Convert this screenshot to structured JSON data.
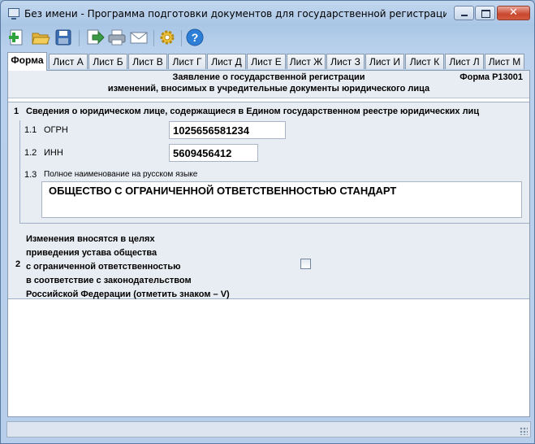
{
  "window": {
    "title": "Без имени - Программа подготовки документов для государственной регистрации. Версия ...",
    "controls": {
      "close": "✕"
    }
  },
  "toolbar": {
    "buttons": [
      "new-document-icon",
      "open-folder-icon",
      "save-icon",
      "export-icon",
      "print-icon",
      "email-icon",
      "settings-gear-icon",
      "help-icon"
    ]
  },
  "tabs": [
    {
      "label": "Форма",
      "active": true
    },
    {
      "label": "Лист А"
    },
    {
      "label": "Лист Б"
    },
    {
      "label": "Лист В"
    },
    {
      "label": "Лист Г"
    },
    {
      "label": "Лист Д"
    },
    {
      "label": "Лист Е"
    },
    {
      "label": "Лист Ж"
    },
    {
      "label": "Лист З"
    },
    {
      "label": "Лист И"
    },
    {
      "label": "Лист К"
    },
    {
      "label": "Лист Л"
    },
    {
      "label": "Лист М"
    }
  ],
  "form": {
    "code": "Форма Р13001",
    "title_line1": "Заявление о государственной регистрации",
    "title_line2": "изменений, вносимых в учредительные документы юридического лица",
    "section1": {
      "number": "1",
      "title": "Сведения о юридическом лице, содержащиеся в Едином государственном реестре юридических лиц",
      "ogrn": {
        "number": "1.1",
        "label": "ОГРН",
        "value": "1025656581234"
      },
      "inn": {
        "number": "1.2",
        "label": "ИНН",
        "value": "5609456412"
      },
      "name": {
        "number": "1.3",
        "label": "Полное наименование на русском языке",
        "value": "ОБЩЕСТВО С ОГРАНИЧЕННОЙ ОТВЕТСТВЕННОСТЬЮ СТАНДАРТ"
      }
    },
    "section2": {
      "number": "2",
      "lines": [
        "Изменения вносятся в целях",
        "приведения устава общества",
        "с ограниченной ответственностью",
        "в соответствие с законодательством",
        "Российской Федерации (отметить знаком – V)"
      ],
      "checked": false
    }
  },
  "colors": {
    "accent": "#3b6fb6",
    "panel_bg": "#e8edf3",
    "window_bg": "#b7cfea"
  }
}
